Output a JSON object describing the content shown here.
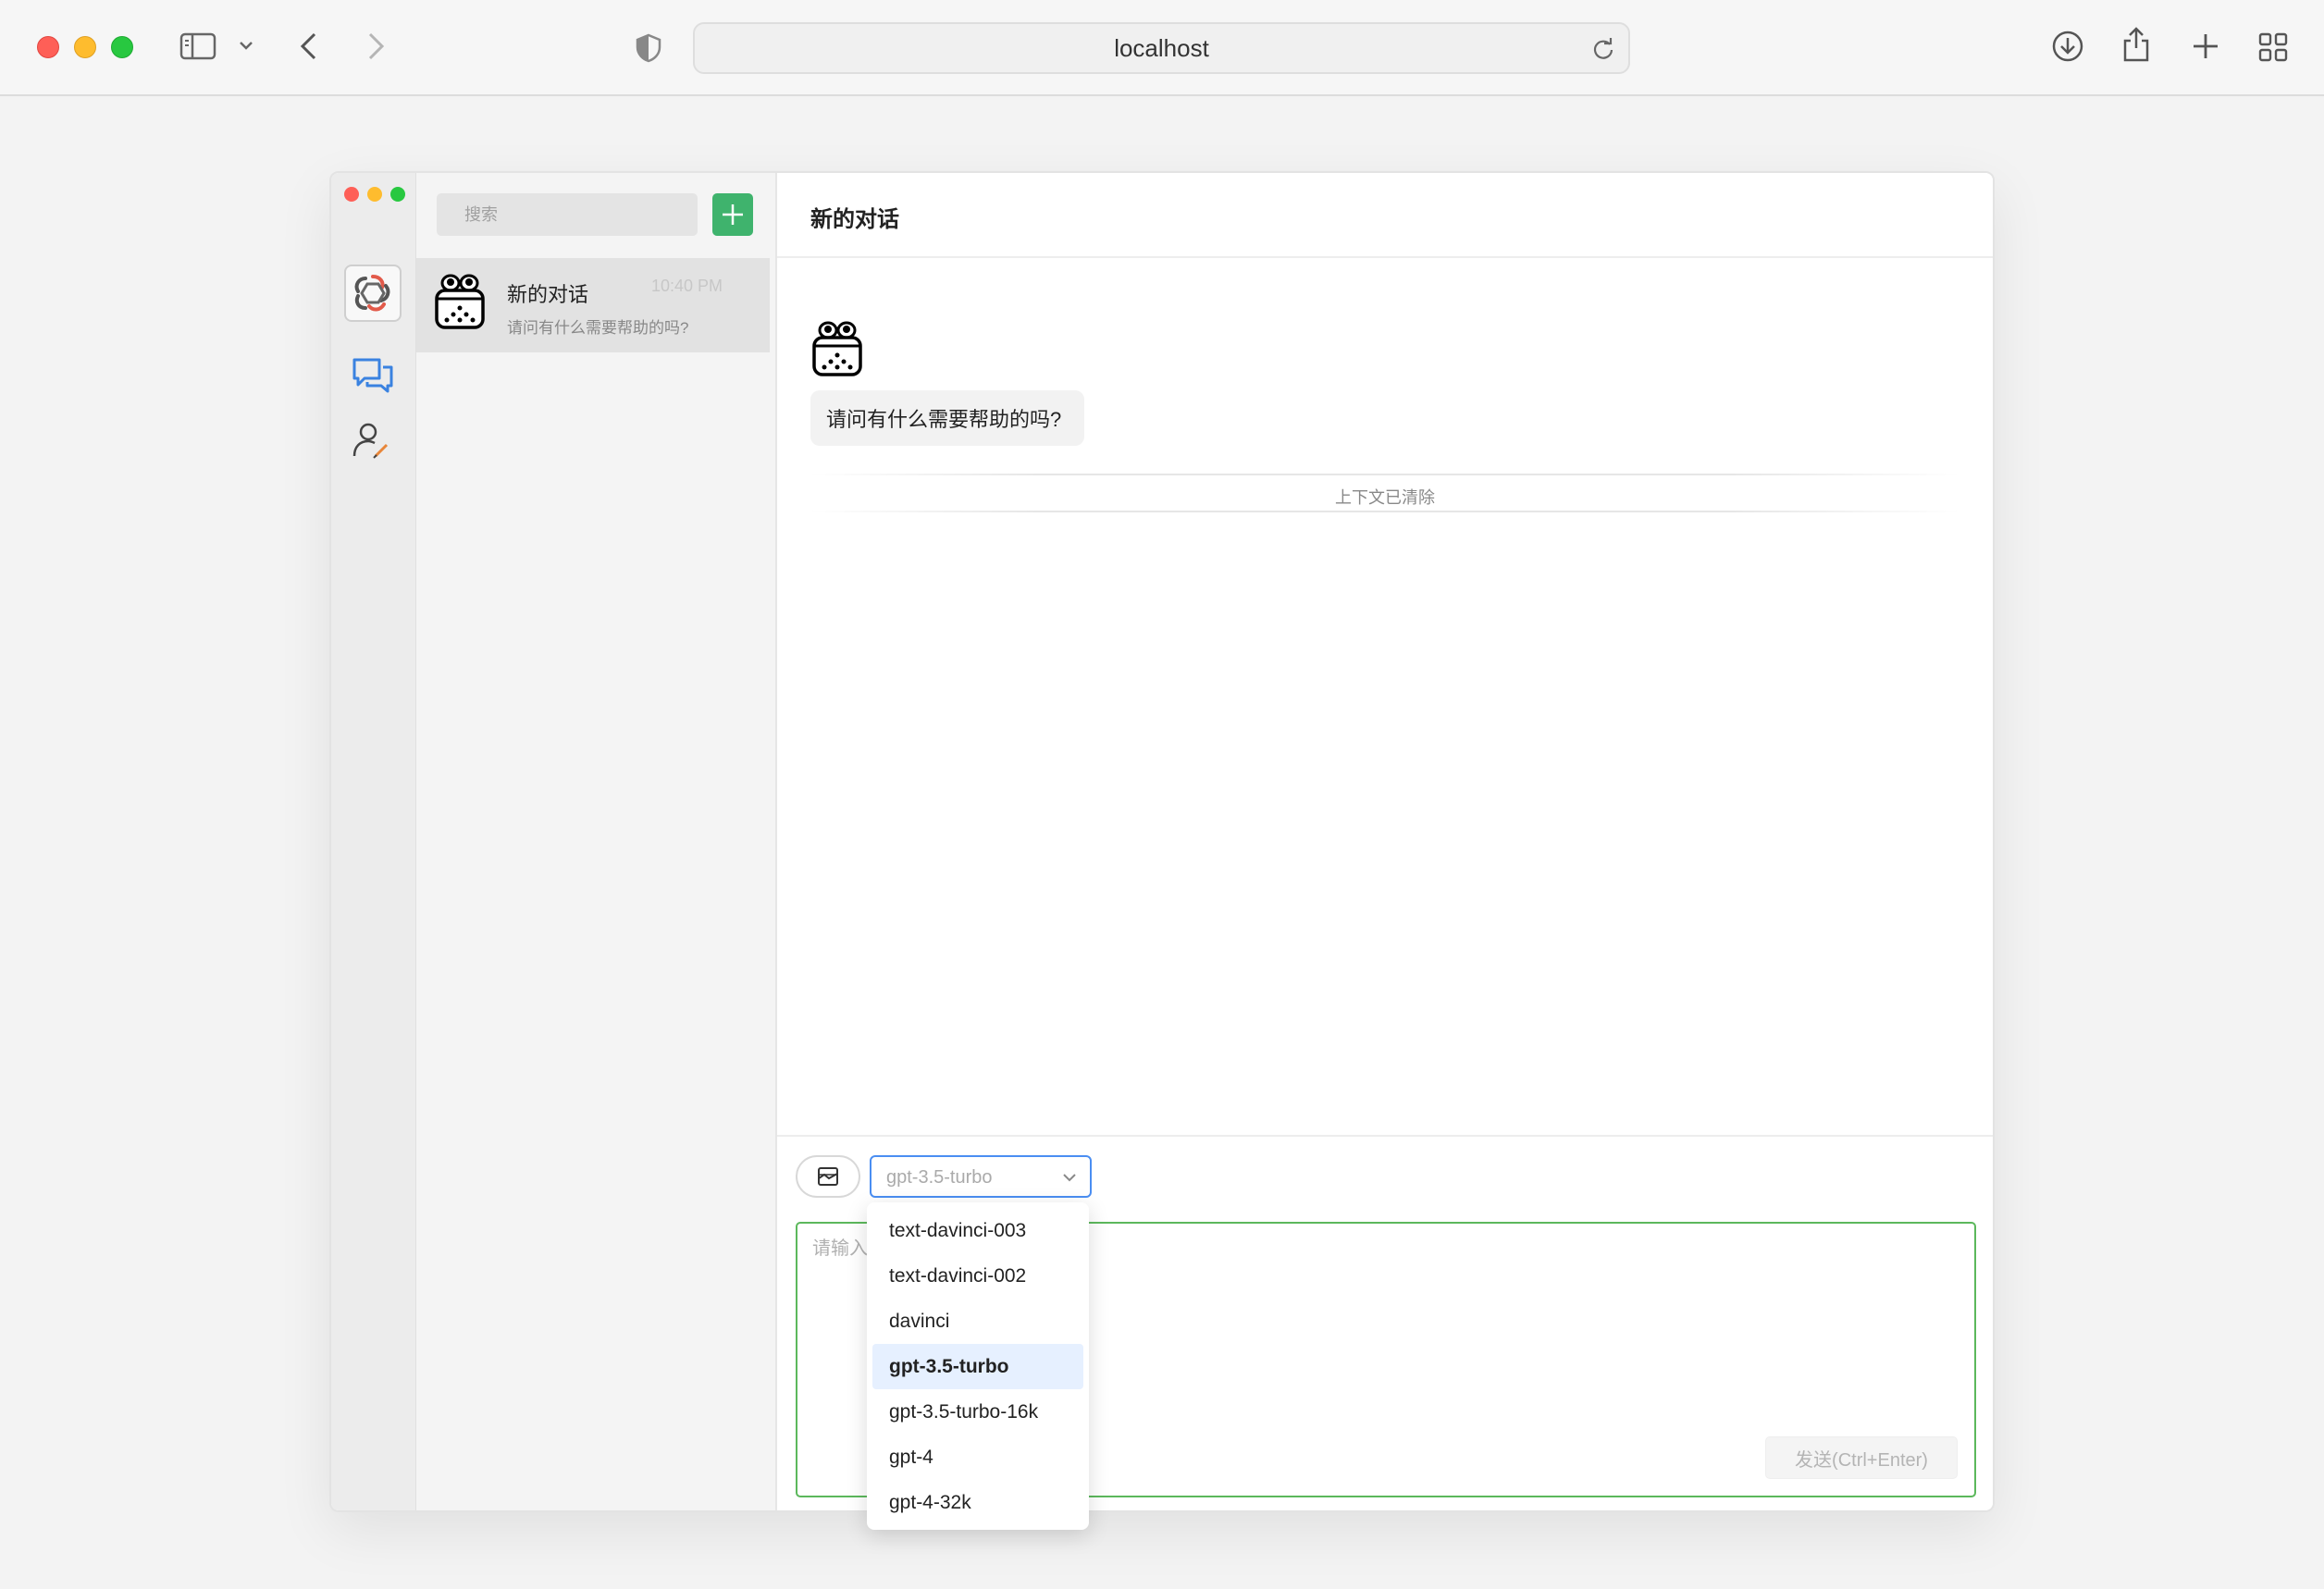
{
  "browser": {
    "url": "localhost"
  },
  "sidebar": {
    "search_placeholder": "搜索",
    "conversations": [
      {
        "title": "新的对话",
        "time": "10:40 PM",
        "preview": "请问有什么需要帮助的吗?"
      }
    ]
  },
  "chat": {
    "title": "新的对话",
    "messages": [
      {
        "role": "assistant",
        "text": "请问有什么需要帮助的吗?"
      }
    ],
    "context_cleared": "上下文已清除"
  },
  "composer": {
    "selected_model": "gpt-3.5-turbo",
    "input_placeholder": "请输入",
    "send_label": "发送(Ctrl+Enter)"
  },
  "model_options": [
    "text-davinci-003",
    "text-davinci-002",
    "davinci",
    "gpt-3.5-turbo",
    "gpt-3.5-turbo-16k",
    "gpt-4",
    "gpt-4-32k"
  ],
  "colors": {
    "accent_green": "#3fb36d",
    "select_border": "#4a8ef2",
    "input_border": "#5cb85c"
  }
}
